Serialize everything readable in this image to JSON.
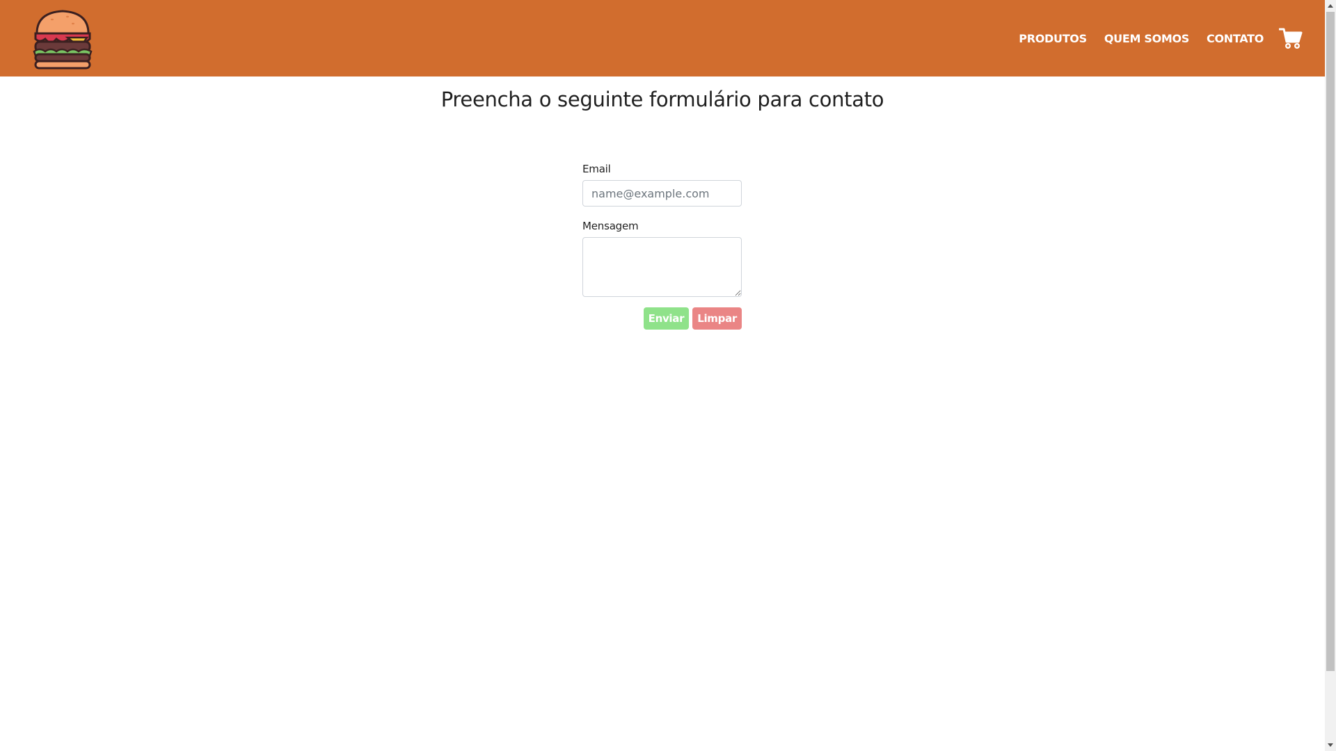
{
  "brand": {
    "logo_icon": "burger-icon",
    "header_color": "#d16d2e"
  },
  "nav": {
    "items": [
      {
        "label": "PRODUTOS"
      },
      {
        "label": "QUEM SOMOS"
      },
      {
        "label": "CONTATO"
      }
    ],
    "cart_icon": "shopping-cart-icon"
  },
  "page": {
    "title": "Preencha o seguinte formulário para contato"
  },
  "form": {
    "email_label": "Email",
    "email_placeholder": "name@example.com",
    "email_value": "",
    "message_label": "Mensagem",
    "message_value": "",
    "send_label": "Enviar",
    "clear_label": "Limpar",
    "send_color": "#8fe28a",
    "clear_color": "#ea8585"
  }
}
